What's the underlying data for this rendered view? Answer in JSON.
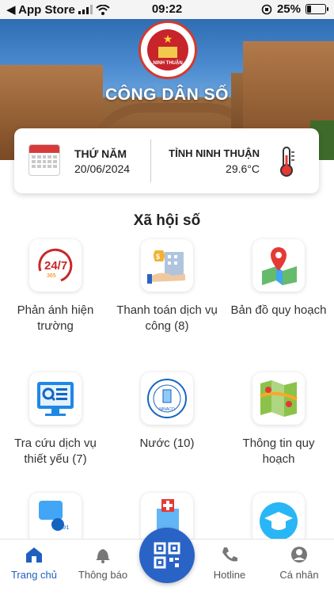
{
  "status_bar": {
    "back_app": "◀ App Store",
    "time": "09:22",
    "battery": "25%",
    "battery_level": 0.25
  },
  "hero": {
    "emblem_text": "NINH THUẬN",
    "title": "CÔNG DÂN SỐ"
  },
  "info_card": {
    "day": "THỨ NĂM",
    "date": "20/06/2024",
    "province": "TỈNH NINH THUẬN",
    "temperature": "29.6°C"
  },
  "section": {
    "title": "Xã hội số"
  },
  "services": [
    {
      "label": "Phản ánh hiện trường",
      "icon": "feedback-24-7-icon"
    },
    {
      "label": "Thanh toán dịch vụ công (8)",
      "icon": "payment-icon"
    },
    {
      "label": "Bản đồ quy hoạch",
      "icon": "map-pin-icon"
    },
    {
      "label": "Tra cứu dịch vụ thiết yếu (7)",
      "icon": "search-monitor-icon"
    },
    {
      "label": "Nước (10)",
      "icon": "water-company-logo-icon"
    },
    {
      "label": "Thông tin quy hoạch",
      "icon": "planning-map-icon"
    },
    {
      "label": "",
      "icon": "digital-data-icon"
    },
    {
      "label": "",
      "icon": "hospital-icon"
    },
    {
      "label": "",
      "icon": "education-icon"
    }
  ],
  "water_logo_text": "NINACO",
  "counter_text": "24/7",
  "counter_sub": "365",
  "bottom_nav": {
    "home": "Trang chủ",
    "notifications": "Thông báo",
    "hotline": "Hotline",
    "profile": "Cá nhân"
  },
  "colors": {
    "accent": "#2a63c6",
    "active": "#1f5fbf"
  }
}
